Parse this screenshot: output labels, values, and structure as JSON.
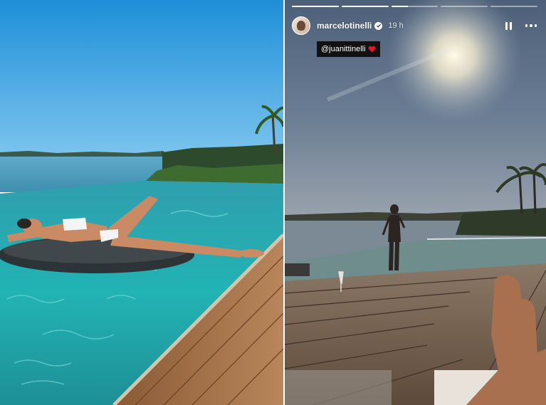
{
  "story": {
    "username": "marcelotinelli",
    "time_ago": "19 h",
    "mention_text": "@juanittinelli",
    "progress": [
      1,
      1,
      0.35,
      0,
      0
    ]
  },
  "colors": {
    "verified_badge": "#ffffff",
    "heart": "#e0182d",
    "sticker_bg": "#111111"
  },
  "icons": {
    "verified": "verified-badge-icon",
    "pause": "pause-icon",
    "more": "more-options-icon",
    "heart": "heart-icon"
  }
}
